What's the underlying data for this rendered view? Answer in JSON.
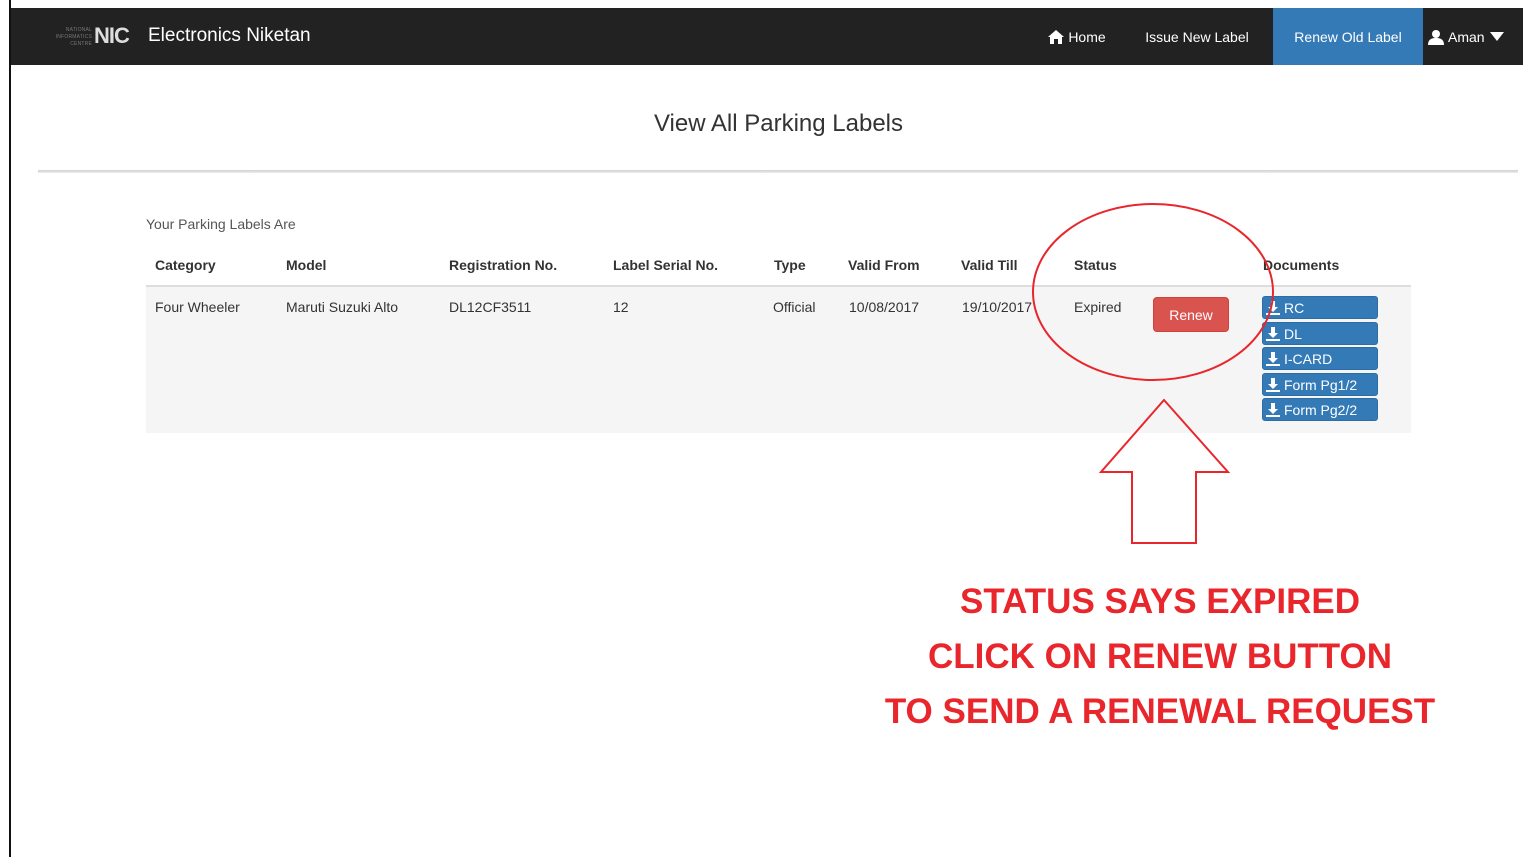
{
  "navbar": {
    "logo_small": "NATIONAL INFORMATICS CENTRE",
    "logo_big": "NIC",
    "title": "Electronics Niketan",
    "items": [
      {
        "label": "Home",
        "icon": "home-icon"
      },
      {
        "label": "Issue New Label"
      },
      {
        "label": "Renew Old Label",
        "active": true
      },
      {
        "label": "Aman",
        "icon": "user-icon"
      }
    ],
    "active_color": "#337ab7",
    "bar_color": "#222222"
  },
  "page": {
    "title": "View All Parking Labels",
    "section_label": "Your Parking Labels Are"
  },
  "table": {
    "headers": [
      "Category",
      "Model",
      "Registration No.",
      "Label Serial No.",
      "Type",
      "Valid From",
      "Valid Till",
      "Status",
      "Documents"
    ],
    "rows": [
      {
        "category": "Four Wheeler",
        "model": "Maruti Suzuki Alto",
        "registration_no": "DL12CF3511",
        "label_serial_no": "12",
        "type": "Official",
        "valid_from": "10/08/2017",
        "valid_till": "19/10/2017",
        "status": "Expired",
        "action_label": "Renew",
        "documents": [
          "RC",
          "DL",
          "I-CARD",
          "Form Pg1/2",
          "Form Pg2/2"
        ]
      }
    ],
    "renew_color": "#d9534f",
    "doc_color": "#337ab7"
  },
  "annotation": {
    "lines": [
      "STATUS SAYS EXPIRED",
      "CLICK ON RENEW BUTTON",
      "TO SEND A RENEWAL REQUEST"
    ],
    "color": "#e8262b"
  }
}
